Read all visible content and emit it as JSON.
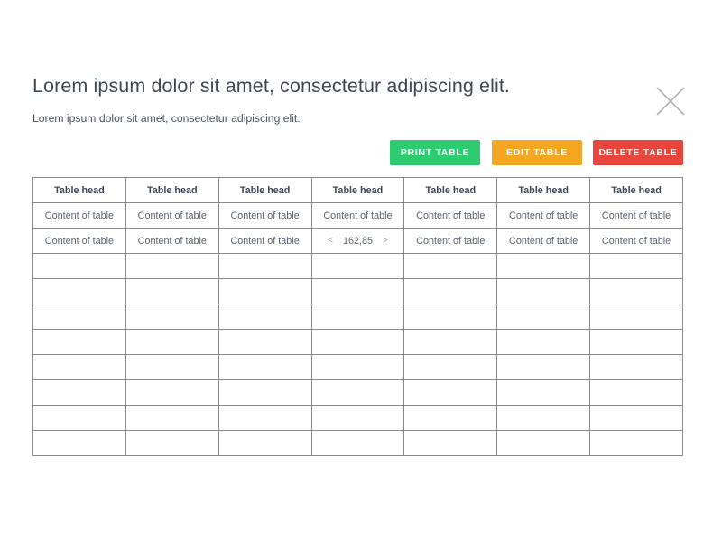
{
  "header": {
    "title": "Lorem ipsum dolor sit amet, consectetur adipiscing elit.",
    "subtitle": "Lorem ipsum dolor sit amet, consectetur adipiscing elit.",
    "close_icon": "close-icon"
  },
  "actions": [
    {
      "label": "PRINT TABLE",
      "color": "#2ecc71",
      "name": "print-table-button"
    },
    {
      "label": "EDIT TABLE",
      "color": "#f5a623",
      "name": "edit-table-button"
    },
    {
      "label": "DELETE TABLE",
      "color": "#e8453c",
      "name": "delete-table-button"
    }
  ],
  "table": {
    "columns": 7,
    "total_rows": 11,
    "headers": [
      "Table head",
      "Table head",
      "Table head",
      "Table head",
      "Table head",
      "Table head",
      "Table head"
    ],
    "rows": [
      {
        "cells": [
          {
            "type": "text",
            "value": "Content of table"
          },
          {
            "type": "text",
            "value": "Content of table"
          },
          {
            "type": "text",
            "value": "Content of table"
          },
          {
            "type": "text",
            "value": "Content of table"
          },
          {
            "type": "text",
            "value": "Content of table"
          },
          {
            "type": "text",
            "value": "Content of table"
          },
          {
            "type": "text",
            "value": "Content of table"
          }
        ]
      },
      {
        "cells": [
          {
            "type": "text",
            "value": "Content of table"
          },
          {
            "type": "text",
            "value": "Content of table"
          },
          {
            "type": "text",
            "value": "Content of table"
          },
          {
            "type": "stepper",
            "value": "162,85",
            "prev": "<",
            "next": ">"
          },
          {
            "type": "text",
            "value": "Content of table"
          },
          {
            "type": "text",
            "value": "Content of table"
          },
          {
            "type": "text",
            "value": "Content of table"
          }
        ]
      },
      {
        "cells": []
      },
      {
        "cells": []
      },
      {
        "cells": []
      },
      {
        "cells": []
      },
      {
        "cells": []
      },
      {
        "cells": []
      },
      {
        "cells": []
      },
      {
        "cells": []
      }
    ]
  },
  "colors": {
    "title_text": "#3c4858",
    "body_text": "#5a6472",
    "border": "#8a8a8a",
    "background": "#ffffff",
    "close_icon": "#b0b0b0"
  }
}
